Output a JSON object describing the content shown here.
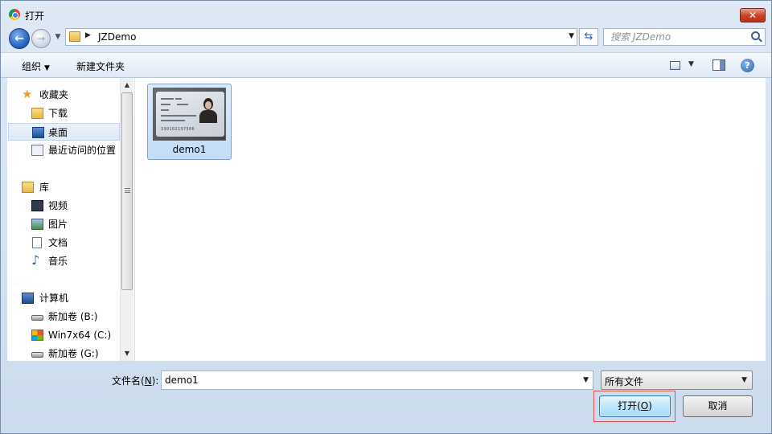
{
  "window": {
    "title": "打开",
    "close_label": "✕"
  },
  "address": {
    "path": "JZDemo",
    "search_placeholder": "搜索 JZDemo"
  },
  "toolbar": {
    "organize_label": "组织",
    "new_folder_label": "新建文件夹",
    "help_label": "?"
  },
  "sidebar": {
    "favorites_header": "收藏夹",
    "favorites": [
      "下载",
      "桌面",
      "最近访问的位置"
    ],
    "selected": "桌面",
    "libraries_header": "库",
    "libraries": [
      "视频",
      "图片",
      "文档",
      "音乐"
    ],
    "computer_header": "计算机",
    "drives": [
      "新加卷 (B:)",
      "Win7x64 (C:)",
      "新加卷 (G:)"
    ]
  },
  "files": [
    {
      "name": "demo1",
      "thumbnail_text": "330102197506"
    }
  ],
  "footer": {
    "filename_label_prefix": "文件名(",
    "filename_label_key": "N",
    "filename_label_suffix": "):",
    "filename_value": "demo1",
    "filetype_value": "所有文件",
    "open_label_prefix": "打开(",
    "open_label_key": "O",
    "open_label_suffix": ")",
    "cancel_label": "取消"
  },
  "colors": {
    "accent": "#2b66c2",
    "highlight_border": "#d9534f",
    "selection": "#c3dcf7"
  }
}
